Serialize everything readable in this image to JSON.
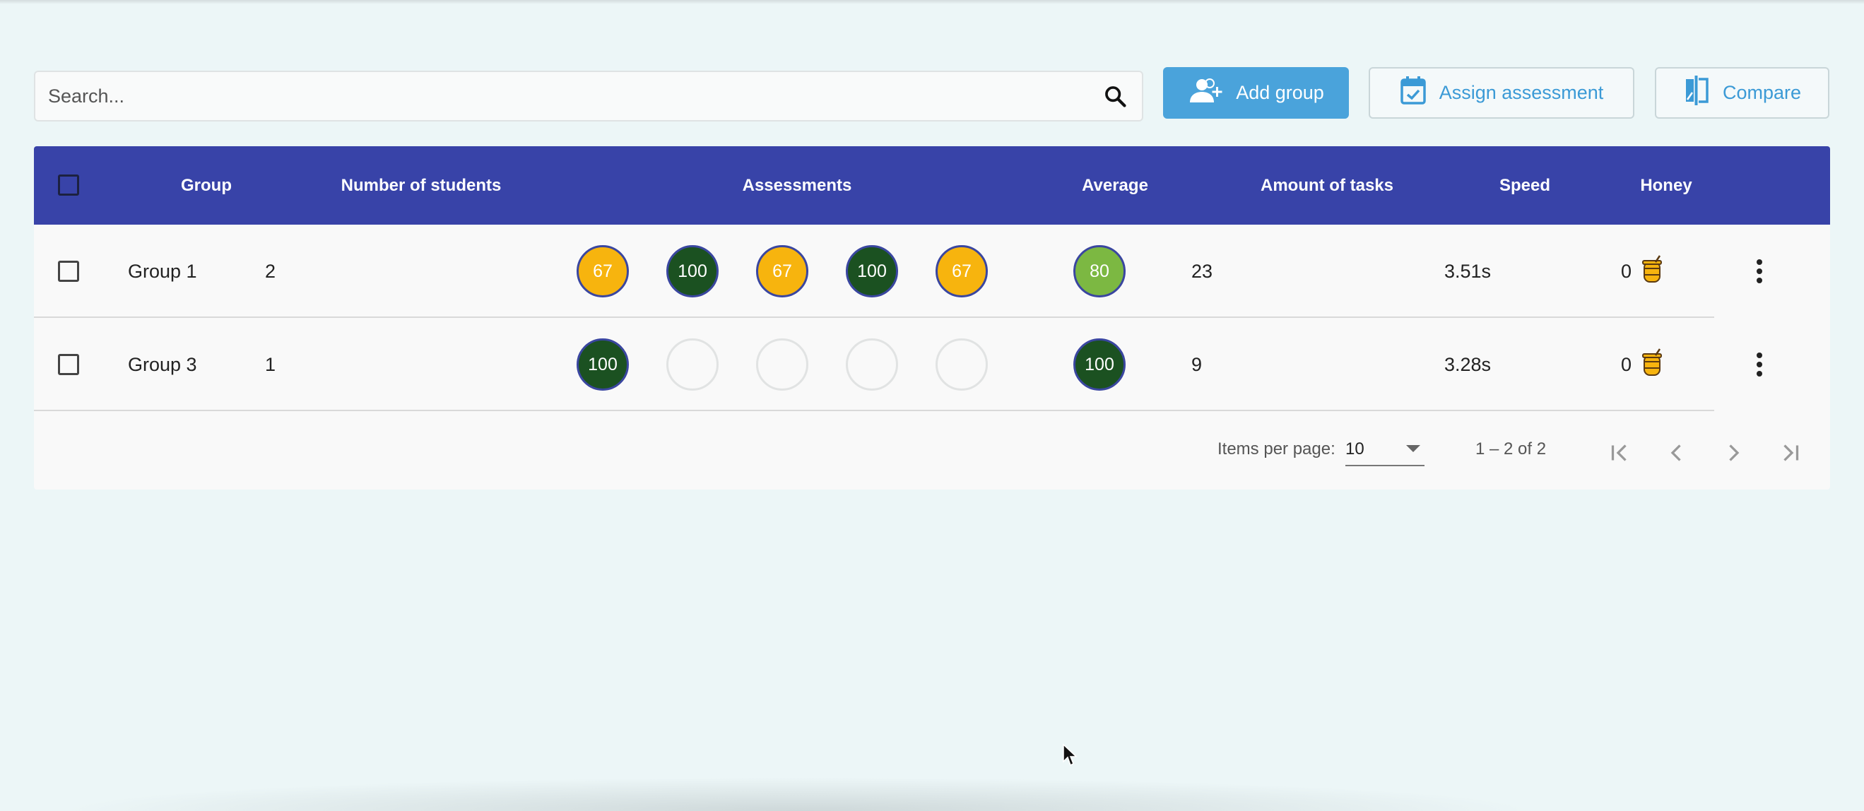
{
  "search": {
    "placeholder": "Search..."
  },
  "toolbar": {
    "add_group_label": "Add group",
    "assign_label": "Assign assessment",
    "compare_label": "Compare"
  },
  "table": {
    "headers": {
      "group": "Group",
      "students": "Number of students",
      "assessments": "Assessments",
      "average": "Average",
      "tasks": "Amount of tasks",
      "speed": "Speed",
      "honey": "Honey"
    },
    "rows": [
      {
        "group": "Group 1",
        "students": "2",
        "assessments": [
          "67",
          "100",
          "67",
          "100",
          "67"
        ],
        "average": "80",
        "tasks": "23",
        "speed": "3.51s",
        "honey": "0"
      },
      {
        "group": "Group 3",
        "students": "1",
        "assessments": [
          "100",
          "",
          "",
          "",
          ""
        ],
        "average": "100",
        "tasks": "9",
        "speed": "3.28s",
        "honey": "0"
      }
    ]
  },
  "pagination": {
    "items_per_page_label": "Items per page:",
    "items_per_page_value": "10",
    "range": "1 – 2 of 2"
  },
  "colors": {
    "header_bg": "#3843a8",
    "primary_button": "#4aa3db",
    "score_yellow": "#f7b40e",
    "score_dark_green": "#1b5121",
    "score_light_green": "#7cb842"
  },
  "icons": [
    "search-icon",
    "add-group-icon",
    "calendar-check-icon",
    "compare-icon",
    "honey-pot-icon",
    "more-vert-icon",
    "first-page-icon",
    "prev-page-icon",
    "next-page-icon",
    "last-page-icon"
  ]
}
